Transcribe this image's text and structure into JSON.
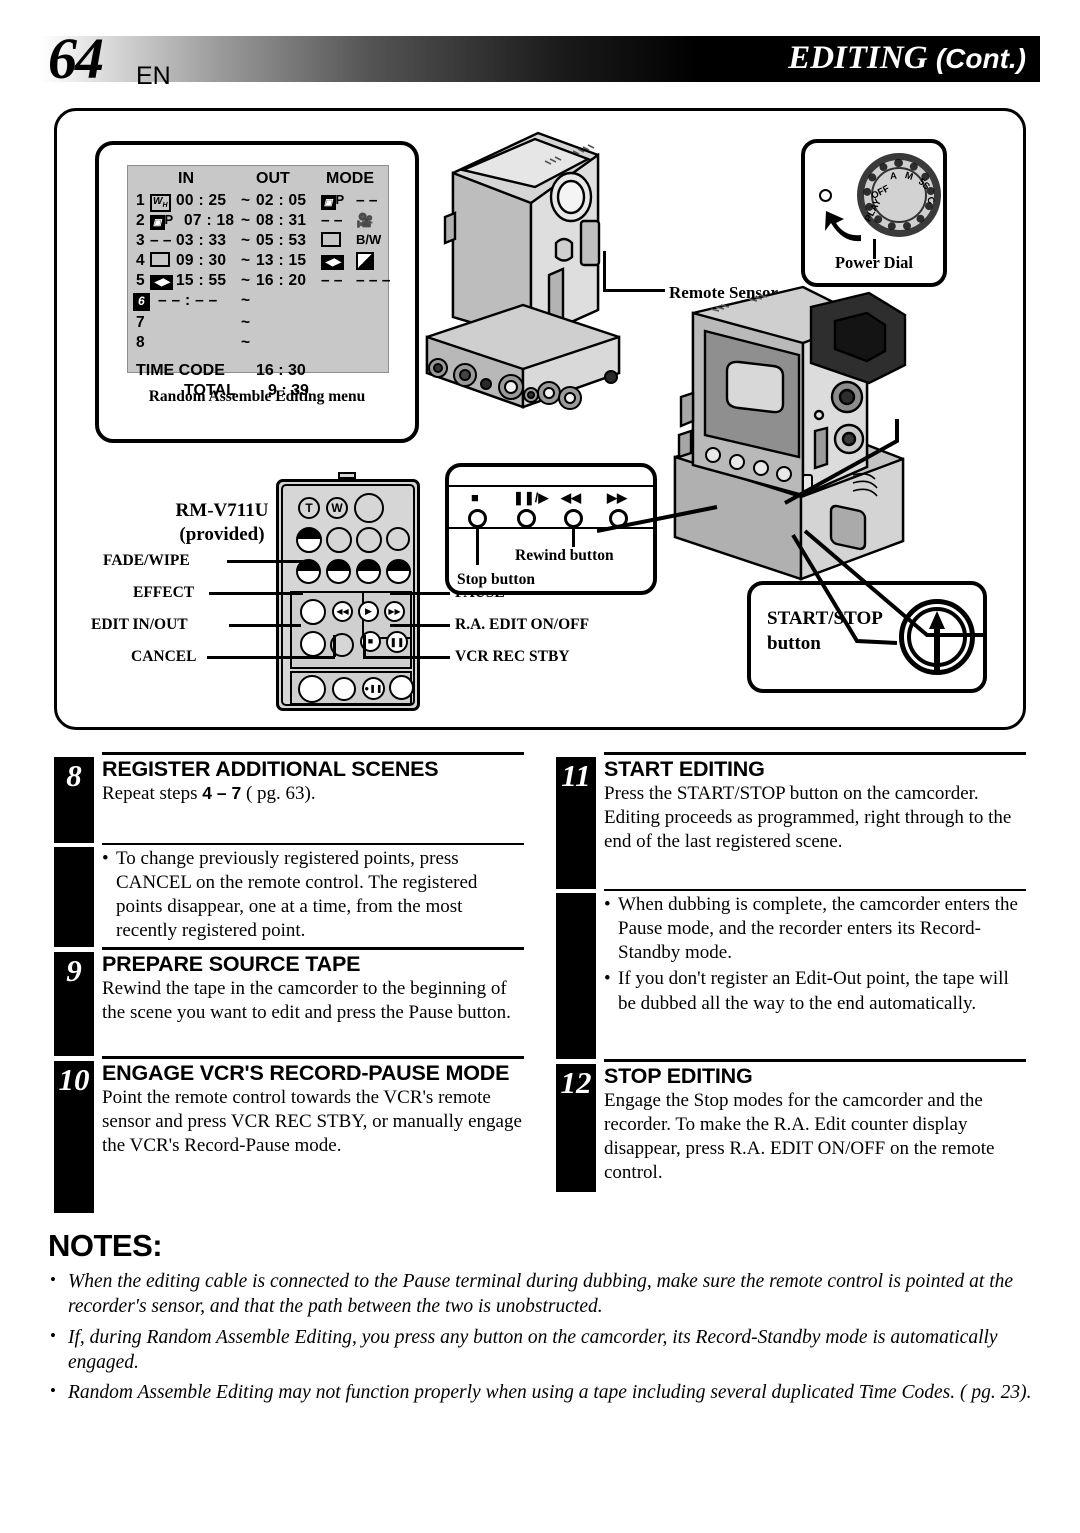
{
  "header": {
    "page_number": "64",
    "lang": "EN",
    "title": "EDITING",
    "title_cont": "(Cont.)"
  },
  "osd": {
    "caption": "Random Assemble Editing menu",
    "columns": {
      "in": "IN",
      "out": "OUT",
      "mode": "MODE"
    },
    "rows": [
      {
        "index": "1",
        "in_mark": "WH",
        "in": "00 : 25",
        "tilde": "~",
        "out": "02 : 05",
        "out_mark": "PIP",
        "out_mark_suffix": "P",
        "mode": "– –"
      },
      {
        "index": "2",
        "in_mark": "PIP",
        "in_mark_suffix": "P",
        "in": "07 : 18",
        "tilde": "~",
        "out": "08 : 31",
        "out_mark": "– –",
        "mode": "camera"
      },
      {
        "index": "3",
        "in_mark": "– –",
        "in": "03 : 33",
        "tilde": "~",
        "out": "05 : 53",
        "out_mark": "box",
        "mode": "B/W"
      },
      {
        "index": "4",
        "in_mark": "box",
        "in": "09 : 30",
        "tilde": "~",
        "out": "13 : 15",
        "out_mark": "wipe",
        "mode": "half"
      },
      {
        "index": "5",
        "in_mark": "wipe",
        "in": "15 : 55",
        "tilde": "~",
        "out": "16 : 20",
        "out_mark": "– –",
        "mode": "– – –"
      },
      {
        "index": "6",
        "in_mark": "",
        "in": "– – : – –",
        "tilde": "~",
        "out": "",
        "out_mark": "",
        "mode": ""
      },
      {
        "index": "7",
        "in_mark": "",
        "in": "",
        "tilde": "~",
        "out": "",
        "out_mark": "",
        "mode": ""
      },
      {
        "index": "8",
        "in_mark": "",
        "in": "",
        "tilde": "~",
        "out": "",
        "out_mark": "",
        "mode": ""
      }
    ],
    "time_code_label": "TIME CODE",
    "time_code_value": "16 : 30",
    "total_label": "TOTAL",
    "total_value": "9 : 39"
  },
  "figure": {
    "remote_sensor_label": "Remote Sensor",
    "power_dial_label": "Power Dial",
    "power_dial_positions": [
      "PLAY",
      "OFF",
      "A",
      "M",
      "5S",
      "C"
    ],
    "remote_model": "RM-V711U",
    "remote_provided": "(provided)",
    "remote_labels_left": [
      "FADE/WIPE",
      "EFFECT",
      "EDIT IN/OUT",
      "CANCEL"
    ],
    "remote_labels_right": [
      "PAUSE",
      "R.A. EDIT ON/OFF",
      "VCR REC STBY"
    ],
    "remote_zoom_t": "T",
    "remote_zoom_w": "W",
    "deck_buttons": [
      "stop-icon",
      "pause-play-icon",
      "rewind-icon",
      "fast-forward-icon"
    ],
    "deck_label_rewind": "Rewind button",
    "deck_label_stop": "Stop button",
    "start_stop_label": "START/STOP",
    "start_stop_label2": "button"
  },
  "steps": [
    {
      "number": "8",
      "title": "REGISTER ADDITIONAL SCENES",
      "text_before": "Repeat steps ",
      "text_bold": "4 – 7",
      "text_after": " ( pg. 63).",
      "bullets": [
        "To change previously registered points, press CANCEL on the remote control. The registered points disappear, one at a time, from the most recently registered point."
      ]
    },
    {
      "number": "9",
      "title": "PREPARE SOURCE TAPE",
      "text": "Rewind the tape in the camcorder to the beginning of the scene you want to edit and press the Pause button.",
      "bullets": []
    },
    {
      "number": "10",
      "title": "ENGAGE VCR'S RECORD-PAUSE MODE",
      "text": "Point the remote control towards the VCR's remote sensor and press VCR REC STBY, or manually engage the VCR's Record-Pause mode.",
      "bullets": []
    },
    {
      "number": "11",
      "title": "START EDITING",
      "text": "Press the START/STOP button on the camcorder. Editing proceeds as programmed, right through to the end of the last registered scene.",
      "bullets": [
        "When dubbing is complete, the camcorder enters the Pause mode, and the recorder enters its Record-Standby mode.",
        "If you don't register an Edit-Out point, the tape will be dubbed all the way to the end automatically."
      ]
    },
    {
      "number": "12",
      "title": "STOP EDITING",
      "text": "Engage the Stop modes for the camcorder and the recorder. To make the R.A. Edit counter display disappear, press R.A. EDIT ON/OFF on the remote control.",
      "bullets": []
    }
  ],
  "notes": {
    "heading": "NOTES:",
    "items": [
      "When the editing cable is connected to the Pause terminal during dubbing, make sure the remote control is pointed at the recorder's sensor, and that the path between the two is unobstructed.",
      "If, during Random Assemble Editing, you press any button on the camcorder, its Record-Standby mode is automatically engaged.",
      "Random Assemble Editing may not function properly when using a tape including several duplicated Time Codes. ( pg. 23)."
    ]
  }
}
